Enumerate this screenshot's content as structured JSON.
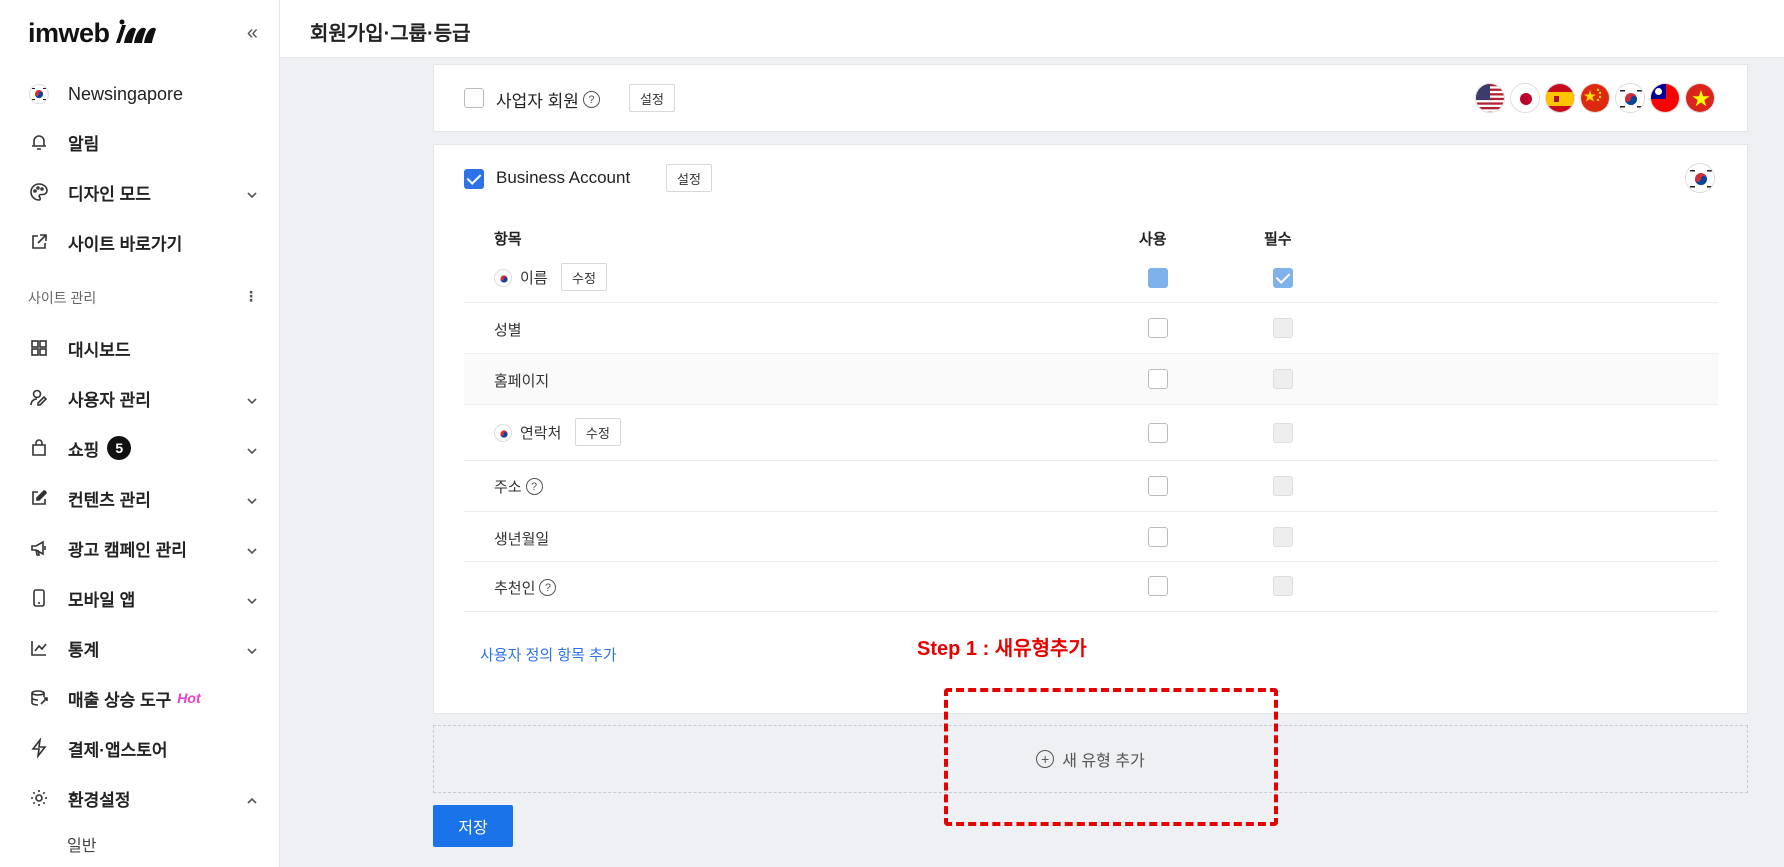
{
  "sidebar": {
    "logo_text": "imweb",
    "site_name": "Newsingapore",
    "items": [
      {
        "label": "알림"
      },
      {
        "label": "디자인 모드"
      },
      {
        "label": "사이트 바로가기"
      },
      {
        "label": "대시보드"
      },
      {
        "label": "사용자 관리"
      },
      {
        "label": "쇼핑"
      },
      {
        "label": "컨텐츠 관리"
      },
      {
        "label": "광고 캠페인 관리"
      },
      {
        "label": "모바일 앱"
      },
      {
        "label": "통계"
      },
      {
        "label": "매출 상승 도구"
      },
      {
        "label": "결제·앱스토어"
      },
      {
        "label": "환경설정"
      }
    ],
    "section_label": "사이트 관리",
    "shopping_badge": "5",
    "hot_label": "Hot",
    "sub_item": "일반"
  },
  "header": {
    "title": "회원가입·그룹·등급"
  },
  "card1": {
    "label": "사업자 회원",
    "settings_button": "설정",
    "flags": [
      "us-flag",
      "jp-flag",
      "es-flag",
      "cn-flag",
      "kr-flag",
      "tw-flag",
      "vn-flag"
    ]
  },
  "card2": {
    "label": "Business Account",
    "settings_button": "설정",
    "columns": {
      "item": "항목",
      "use": "사용",
      "required": "필수"
    },
    "rows": [
      {
        "name": "이름",
        "edit": "수정"
      },
      {
        "name": "성별"
      },
      {
        "name": "홈페이지"
      },
      {
        "name": "연락처",
        "edit": "수정"
      },
      {
        "name": "주소"
      },
      {
        "name": "생년월일"
      },
      {
        "name": "추천인"
      }
    ],
    "add_custom_link": "사용자 정의 항목 추가"
  },
  "new_type_button": "새 유형 추가",
  "save_button": "저장",
  "annotation": {
    "step_label": "Step 1 : 새유형추가"
  },
  "colors": {
    "primary": "#1a73e8",
    "annotation": "#e60000",
    "hot": "#e83ecf"
  }
}
